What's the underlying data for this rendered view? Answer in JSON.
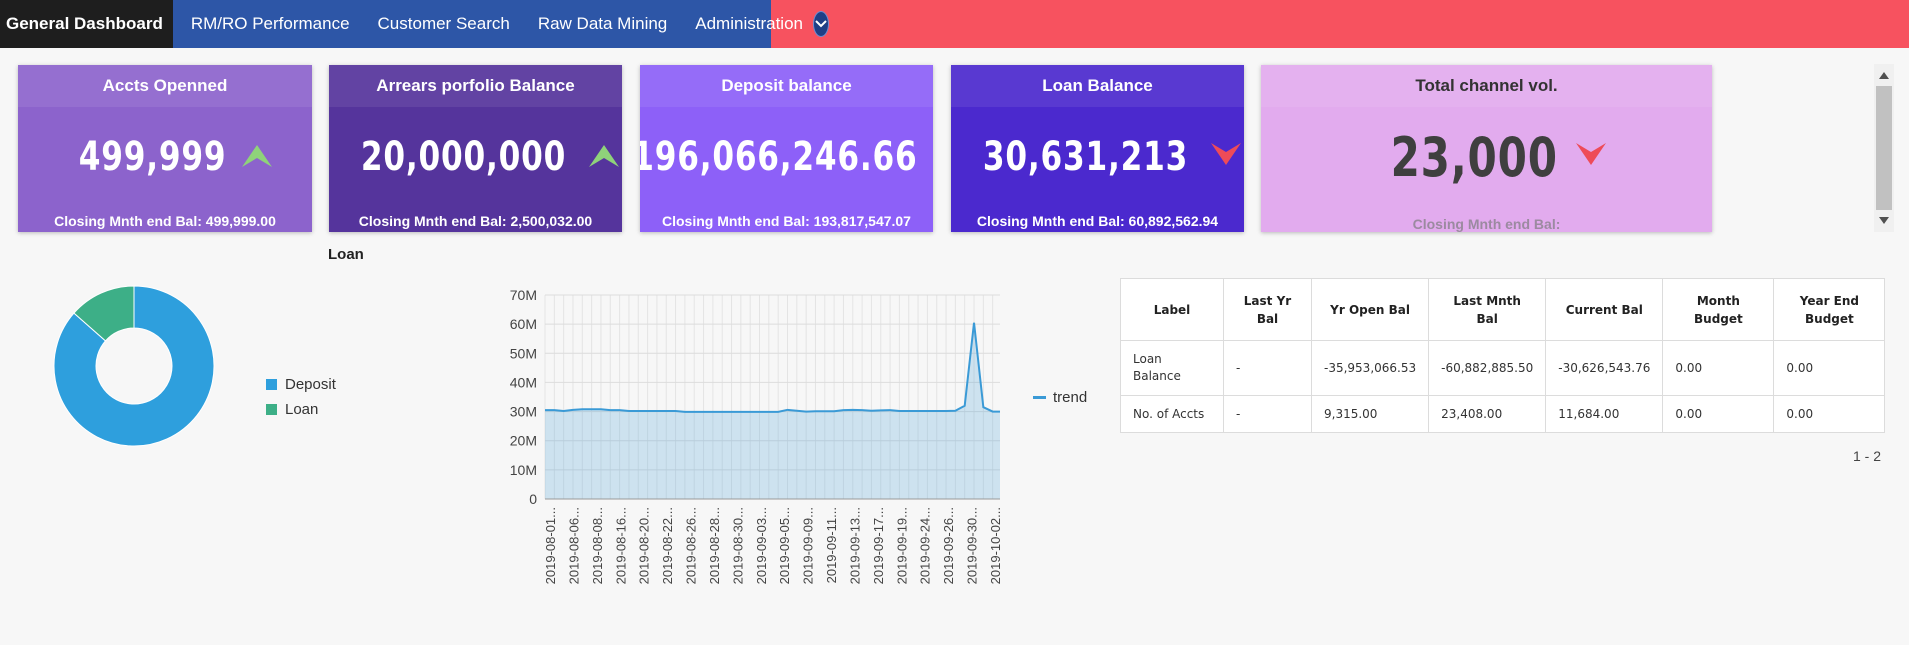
{
  "nav": {
    "tabs": [
      {
        "label": "General Dashboard",
        "active": true
      },
      {
        "label": "RM/RO Performance"
      },
      {
        "label": "Customer Search"
      },
      {
        "label": "Raw Data Mining"
      },
      {
        "label": "Administration"
      }
    ],
    "more_icon": "chevron-down-icon",
    "colors": {
      "bar": "#f7525f",
      "tabs": "#2d56a7",
      "active": "#1e1e1e"
    }
  },
  "kpis": [
    {
      "title": "Accts Openned",
      "value": "499,999",
      "trend": "up",
      "footer": "Closing Mnth end Bal: 499,999.00",
      "bg": "#8c63cc"
    },
    {
      "title": "Arrears porfolio Balance",
      "value": "20,000,000",
      "trend": "up",
      "footer": "Closing Mnth end Bal: 2,500,032.00",
      "bg": "#55349c"
    },
    {
      "title": "Deposit balance",
      "value": "196,066,246.66",
      "trend": "up",
      "footer": "Closing Mnth end Bal: 193,817,547.07",
      "bg": "#8d60f8"
    },
    {
      "title": "Loan Balance",
      "value": "30,631,213",
      "trend": "down",
      "footer": "Closing Mnth end Bal: 60,892,562.94",
      "bg": "#4b29ce"
    },
    {
      "title": "Total channel vol.",
      "value": "23,000",
      "trend": "down",
      "footer": "Closing Mnth end Bal:",
      "bg": "#e2abee"
    }
  ],
  "section_title": "Loan",
  "donut": {
    "legend": [
      {
        "label": "Deposit",
        "color": "#2e9fdd"
      },
      {
        "label": "Loan",
        "color": "#3daf87"
      }
    ]
  },
  "trend_legend": "trend",
  "chart_data": [
    {
      "type": "pie",
      "categories": [
        "Deposit",
        "Loan"
      ],
      "values": [
        86.5,
        13.5
      ],
      "colors": [
        "#2e9fdd",
        "#3daf87"
      ],
      "legend": "right"
    },
    {
      "type": "area",
      "series": [
        {
          "name": "trend",
          "color": "#3a9ad6",
          "values": [
            30.5,
            30.5,
            30.2,
            30.6,
            30.8,
            30.8,
            30.8,
            30.5,
            30.5,
            30.2,
            30.2,
            30.2,
            30.2,
            30.2,
            30.2,
            29.9,
            29.9,
            29.9,
            29.9,
            29.9,
            29.9,
            29.9,
            29.9,
            29.9,
            29.9,
            29.9,
            30.6,
            30.3,
            30.0,
            30.1,
            30.1,
            30.1,
            30.5,
            30.6,
            30.5,
            30.3,
            30.4,
            30.5,
            30.2,
            30.2,
            30.2,
            30.2,
            30.2,
            30.2,
            30.3,
            32.0,
            60.5,
            31.5,
            30.0,
            30.0
          ]
        }
      ],
      "x_tick_labels": [
        "2019-08-01...",
        "2019-08-06...",
        "2019-08-08...",
        "2019-08-16...",
        "2019-08-20...",
        "2019-08-22...",
        "2019-08-26...",
        "2019-08-28...",
        "2019-08-30...",
        "2019-09-03...",
        "2019-09-05...",
        "2019-09-09...",
        "2019-09-11...",
        "2019-09-13...",
        "2019-09-17...",
        "2019-09-19...",
        "2019-09-24...",
        "2019-09-26...",
        "2019-09-30...",
        "2019-10-02..."
      ],
      "y_ticks": [
        "0",
        "10M",
        "20M",
        "30M",
        "40M",
        "50M",
        "60M",
        "70M"
      ],
      "ylim": [
        0,
        70
      ],
      "grid": true,
      "legend": "right"
    }
  ],
  "table": {
    "headers": [
      "Label",
      "Last Yr\nBal",
      "Yr Open Bal",
      "Last Mnth\nBal",
      "Current Bal",
      "Month\nBudget",
      "Year End\nBudget"
    ],
    "rows": [
      [
        "Loan\nBalance",
        "-",
        "-35,953,066.53",
        "-60,882,885.50",
        "-30,626,543.76",
        "0.00",
        "0.00"
      ],
      [
        "No. of Accts",
        "-",
        "9,315.00",
        "23,408.00",
        "11,684.00",
        "0.00",
        "0.00"
      ]
    ],
    "pager": "1 - 2"
  }
}
